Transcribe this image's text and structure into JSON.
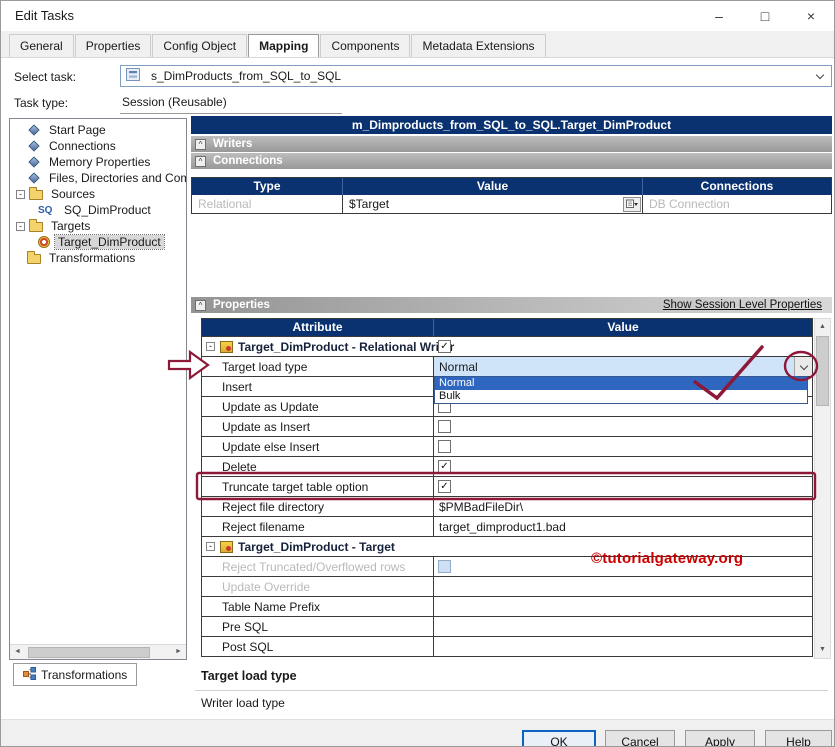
{
  "window": {
    "title": "Edit Tasks",
    "minimize": "–",
    "maximize": "□",
    "close": "×"
  },
  "tabs": {
    "items": [
      {
        "label": "General",
        "active": false
      },
      {
        "label": "Properties",
        "active": false
      },
      {
        "label": "Config Object",
        "active": false
      },
      {
        "label": "Mapping",
        "active": true
      },
      {
        "label": "Components",
        "active": false
      },
      {
        "label": "Metadata Extensions",
        "active": false
      }
    ]
  },
  "task_form": {
    "select_label": "Select task:",
    "select_value": "s_DimProducts_from_SQL_to_SQL",
    "type_label": "Task type:",
    "type_value": "Session (Reusable)"
  },
  "tree": {
    "items": [
      {
        "label": "Start Page",
        "icon": "start-page-icon",
        "type": "gem",
        "depth": 1
      },
      {
        "label": "Connections",
        "icon": "connections-icon",
        "type": "gem",
        "depth": 1
      },
      {
        "label": "Memory Properties",
        "icon": "memory-properties-icon",
        "type": "gem",
        "depth": 1
      },
      {
        "label": "Files, Directories and Com",
        "icon": "files-directories-icon",
        "type": "gem",
        "depth": 1
      },
      {
        "label": "Sources",
        "icon": "folder-icon",
        "type": "folder",
        "depth": 0,
        "expander": "-"
      },
      {
        "label": "SQ_DimProduct",
        "icon": "source-qualifier-icon",
        "type": "sq",
        "depth": 2
      },
      {
        "label": "Targets",
        "icon": "folder-icon",
        "type": "folder",
        "depth": 0,
        "expander": "-"
      },
      {
        "label": "Target_DimProduct",
        "icon": "target-icon",
        "type": "target",
        "depth": 2,
        "selected": true
      },
      {
        "label": "Transformations",
        "icon": "folder-icon",
        "type": "folder",
        "depth": 1
      }
    ],
    "bottom_tab": "Transformations"
  },
  "mapping_panel": {
    "header": "m_Dimproducts_from_SQL_to_SQL.Target_DimProduct",
    "writers_label": "Writers",
    "connections_label": "Connections",
    "connections_table": {
      "headers": [
        "Type",
        "Value",
        "Connections"
      ],
      "row": {
        "type": "Relational",
        "value": "$Target",
        "connection": "DB Connection"
      }
    },
    "properties_label": "Properties",
    "session_link": "Show Session Level Properties",
    "properties_table": {
      "headers": [
        "Attribute",
        "Value"
      ],
      "rows": [
        {
          "kind": "group",
          "label": "Target_DimProduct - Relational Writer",
          "partial_checkbox": true
        },
        {
          "kind": "attr",
          "label": "Target load type",
          "value_kind": "combo"
        },
        {
          "kind": "attr",
          "label": "Insert",
          "value_kind": "covered"
        },
        {
          "kind": "attr",
          "label": "Update as Update",
          "value_kind": "checkbox",
          "checked": false
        },
        {
          "kind": "attr",
          "label": "Update as Insert",
          "value_kind": "checkbox",
          "checked": false
        },
        {
          "kind": "attr",
          "label": "Update else Insert",
          "value_kind": "checkbox",
          "checked": false
        },
        {
          "kind": "attr",
          "label": "Delete",
          "value_kind": "checkbox",
          "checked": true
        },
        {
          "kind": "attr",
          "label": "Truncate target table option",
          "value_kind": "checkbox",
          "checked": true
        },
        {
          "kind": "attr",
          "label": "Reject file directory",
          "value_kind": "text",
          "value": "$PMBadFileDir\\"
        },
        {
          "kind": "attr",
          "label": "Reject filename",
          "value_kind": "text",
          "value": "target_dimproduct1.bad"
        },
        {
          "kind": "group",
          "label": "Target_DimProduct - Target"
        },
        {
          "kind": "attr",
          "label": "Reject Truncated/Overflowed rows",
          "value_kind": "checkbox-disabled",
          "disabled": true
        },
        {
          "kind": "attr",
          "label": "Update Override",
          "value_kind": "empty",
          "disabled": true
        },
        {
          "kind": "attr",
          "label": "Table Name Prefix",
          "value_kind": "empty"
        },
        {
          "kind": "attr",
          "label": "Pre SQL",
          "value_kind": "empty"
        },
        {
          "kind": "attr",
          "label": "Post SQL",
          "value_kind": "empty"
        }
      ]
    },
    "load_type_dropdown": {
      "value": "Normal",
      "options": [
        {
          "label": "Normal",
          "selected": true
        },
        {
          "label": "Bulk",
          "selected": false
        }
      ]
    },
    "description": {
      "title": "Target load type",
      "text": "Writer load type"
    }
  },
  "footer": {
    "buttons": [
      {
        "label": "OK",
        "default": true
      },
      {
        "label": "Cancel"
      },
      {
        "label": "Apply"
      },
      {
        "label": "Help"
      }
    ]
  },
  "annotations": {
    "watermark": "©tutorialgateway.org",
    "color": "#8e1838",
    "watermark_color": "#cc0000"
  },
  "colors": {
    "header_navy": "#0a3170",
    "selection_blue": "#2f67c0",
    "combo_highlight": "#cfe4f8",
    "disabled_text": "#b9b9b9"
  }
}
